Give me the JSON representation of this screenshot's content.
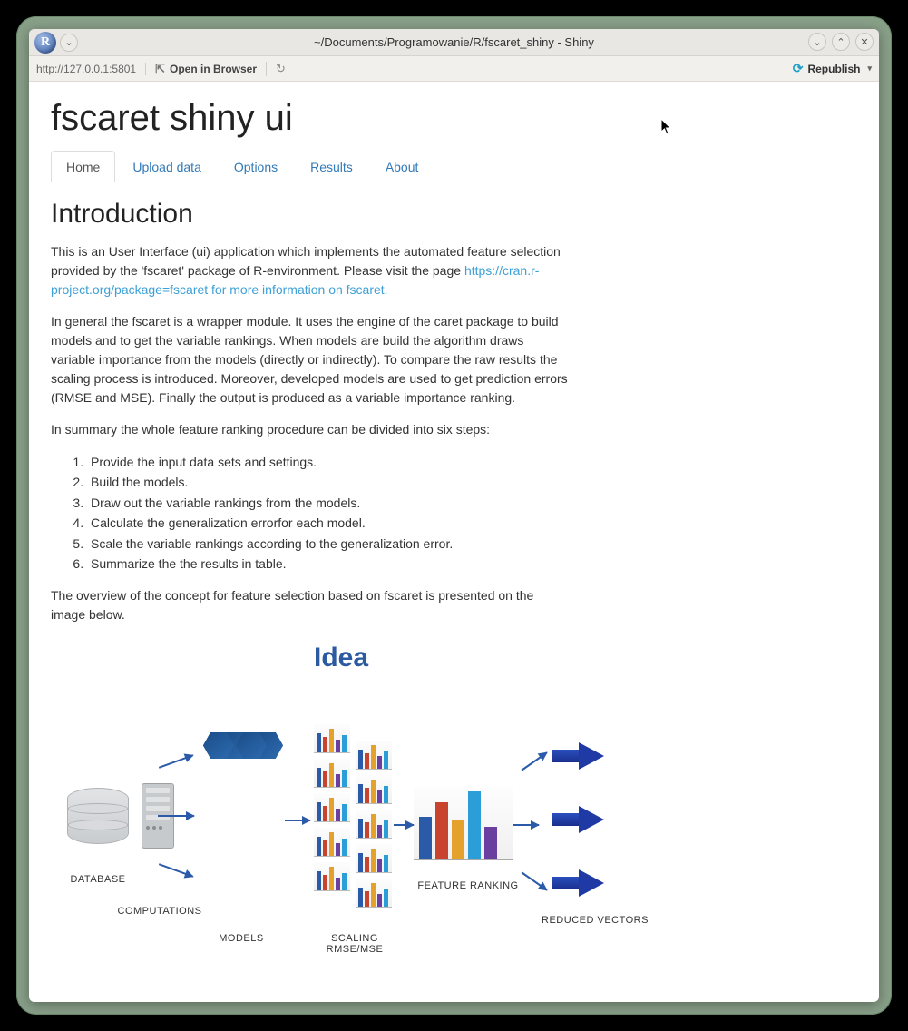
{
  "window": {
    "title": "~/Documents/Programowanie/R/fscaret_shiny - Shiny"
  },
  "toolbar": {
    "url": "http://127.0.0.1:5801",
    "open_in_browser": "Open in Browser",
    "republish": "Republish"
  },
  "page": {
    "title": "fscaret shiny ui"
  },
  "tabs": [
    {
      "label": "Home"
    },
    {
      "label": "Upload data"
    },
    {
      "label": "Options"
    },
    {
      "label": "Results"
    },
    {
      "label": "About"
    }
  ],
  "intro": {
    "heading": "Introduction",
    "p1": "This is an User Interface (ui) application which implements the automated feature selection provided by the 'fscaret' package of R-environment. Please visit the page ",
    "link": "https://cran.r-project.org/package=fscaret for more information on fscaret.",
    "p2": "In general the fscaret is a wrapper module. It uses the engine of the caret package to build models and to get the variable rankings. When models are build the algorithm draws variable importance from the models (directly or indirectly). To compare the raw results the scaling process is introduced. Moreover, developed models are used to get prediction errors (RMSE and MSE). Finally the output is produced as a variable importance ranking.",
    "p3": "In summary the whole feature ranking procedure can be divided into six steps:",
    "steps": [
      "Provide the input data sets and settings.",
      "Build the models.",
      "Draw out the variable rankings from the models.",
      "Calculate the generalization errorfor each model.",
      "Scale the variable rankings according to the generalization error.",
      "Summarize the the results in table."
    ],
    "p4": "The overview of the concept for feature selection based on fscaret is presented on the image below."
  },
  "diagram": {
    "title": "Idea",
    "labels": {
      "database": "DATABASE",
      "computations": "COMPUTATIONS",
      "models": "MODELS",
      "scaling": "SCALING\nRMSE/MSE",
      "feature_ranking": "FEATURE RANKING",
      "reduced_vectors": "REDUCED VECTORS"
    }
  }
}
